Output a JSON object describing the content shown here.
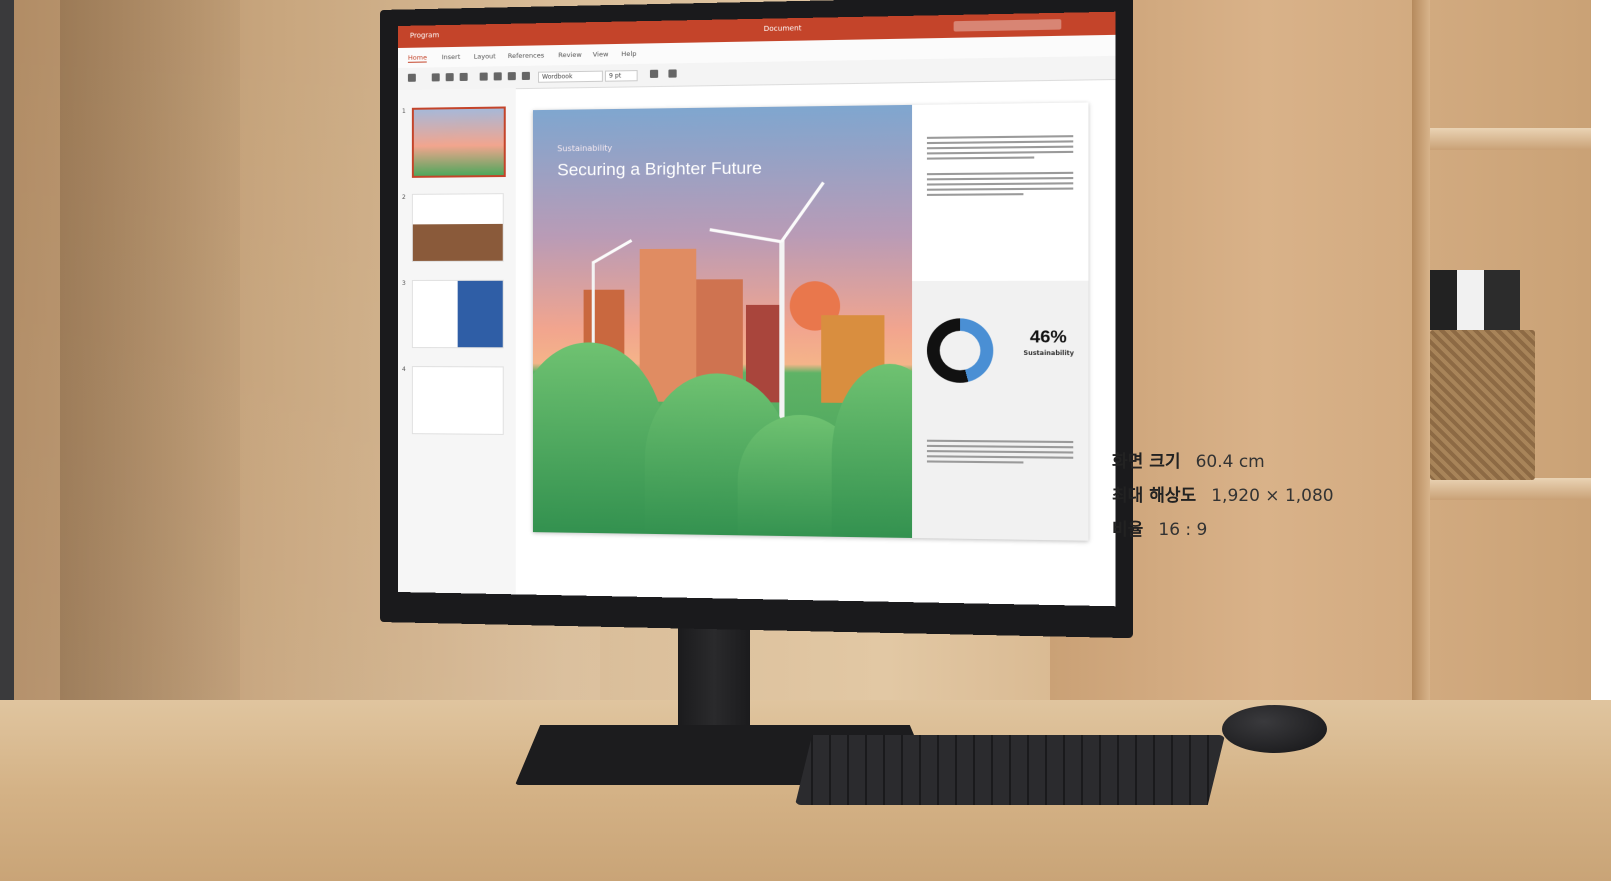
{
  "screen_app": {
    "app_name": "Program",
    "document_title": "Document",
    "ribbon_tabs": [
      "Home",
      "Insert",
      "Layout",
      "References",
      "Review",
      "View",
      "Help"
    ],
    "font_name": "Wordbook",
    "font_size": "9 pt",
    "slide_numbers": [
      "1",
      "2",
      "3",
      "4"
    ],
    "slide": {
      "kicker": "Sustainability",
      "headline": "Securing a Brighter Future",
      "stat_value": "46%",
      "stat_label": "Sustainability",
      "stat_fraction": 0.46
    }
  },
  "specs": [
    {
      "label": "화면 크기",
      "value": "60.4 cm"
    },
    {
      "label": "최대 해상도",
      "value": "1,920 × 1,080"
    },
    {
      "label": "비율",
      "value": "16 : 9"
    }
  ],
  "colors": {
    "accent": "#c4442a",
    "chart_blue": "#4a8fd4"
  }
}
